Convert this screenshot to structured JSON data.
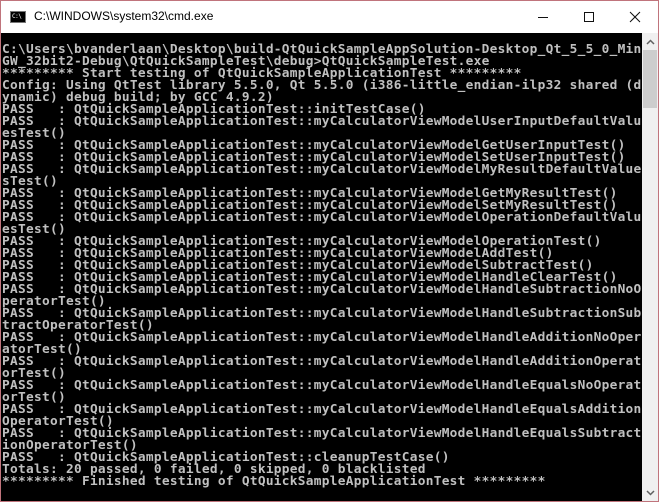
{
  "window": {
    "title": "C:\\WINDOWS\\system32\\cmd.exe",
    "icon": "cmd-icon",
    "icon_text": "C:\\",
    "controls": [
      "minimize",
      "maximize",
      "close"
    ]
  },
  "console": {
    "lines": [
      "C:\\Users\\bvanderlaan\\Desktop\\build-QtQuickSampleAppSolution-Desktop_Qt_5_5_0_Min",
      "GW_32bit2-Debug\\QtQuickSampleTest\\debug>QtQuickSampleTest.exe",
      "********* Start testing of QtQuickSampleApplicationTest *********",
      "Config: Using QtTest library 5.5.0, Qt 5.5.0 (i386-little_endian-ilp32 shared (d",
      "ynamic) debug build; by GCC 4.9.2)",
      "PASS   : QtQuickSampleApplicationTest::initTestCase()",
      "PASS   : QtQuickSampleApplicationTest::myCalculatorViewModelUserInputDefaultValu",
      "esTest()",
      "PASS   : QtQuickSampleApplicationTest::myCalculatorViewModelGetUserInputTest()",
      "PASS   : QtQuickSampleApplicationTest::myCalculatorViewModelSetUserInputTest()",
      "PASS   : QtQuickSampleApplicationTest::myCalculatorViewModelMyResultDefaultValue",
      "sTest()",
      "PASS   : QtQuickSampleApplicationTest::myCalculatorViewModelGetMyResultTest()",
      "PASS   : QtQuickSampleApplicationTest::myCalculatorViewModelSetMyResultTest()",
      "PASS   : QtQuickSampleApplicationTest::myCalculatorViewModelOperationDefaultValu",
      "esTest()",
      "PASS   : QtQuickSampleApplicationTest::myCalculatorViewModelOperationTest()",
      "PASS   : QtQuickSampleApplicationTest::myCalculatorViewModelAddTest()",
      "PASS   : QtQuickSampleApplicationTest::myCalculatorViewModelSubtractTest()",
      "PASS   : QtQuickSampleApplicationTest::myCalculatorViewModelHandleClearTest()",
      "PASS   : QtQuickSampleApplicationTest::myCalculatorViewModelHandleSubtractionNoO",
      "peratorTest()",
      "PASS   : QtQuickSampleApplicationTest::myCalculatorViewModelHandleSubtractionSub",
      "tractOperatorTest()",
      "PASS   : QtQuickSampleApplicationTest::myCalculatorViewModelHandleAdditionNoOper",
      "atorTest()",
      "PASS   : QtQuickSampleApplicationTest::myCalculatorViewModelHandleAdditionOperat",
      "orTest()",
      "PASS   : QtQuickSampleApplicationTest::myCalculatorViewModelHandleEqualsNoOperat",
      "orTest()",
      "PASS   : QtQuickSampleApplicationTest::myCalculatorViewModelHandleEqualsAddition",
      "OperatorTest()",
      "PASS   : QtQuickSampleApplicationTest::myCalculatorViewModelHandleEqualsSubtract",
      "ionOperatorTest()",
      "PASS   : QtQuickSampleApplicationTest::cleanupTestCase()",
      "Totals: 20 passed, 0 failed, 0 skipped, 0 blacklisted",
      "********* Finished testing of QtQuickSampleApplicationTest *********"
    ]
  },
  "scrollbar": {
    "up_icon": "chevron-up-icon",
    "down_icon": "chevron-down-icon"
  },
  "colors": {
    "console_bg": "#000000",
    "console_fg": "#c0c0c0",
    "window_border": "#c0747c"
  }
}
